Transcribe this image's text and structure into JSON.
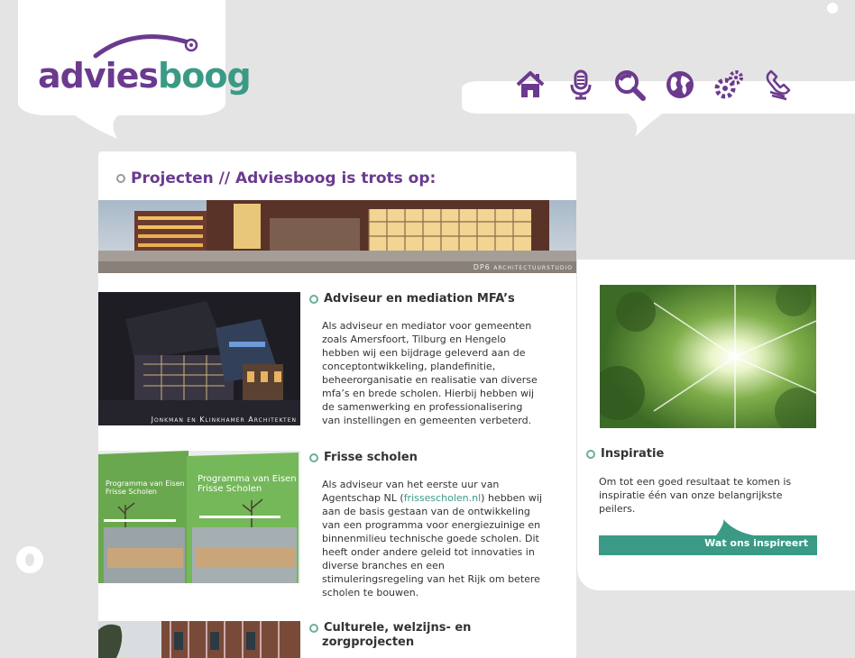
{
  "logo": {
    "part1": "advies",
    "part2": "boog"
  },
  "nav": [
    {
      "name": "home-icon"
    },
    {
      "name": "microphone-icon"
    },
    {
      "name": "search-icon"
    },
    {
      "name": "globe-icon"
    },
    {
      "name": "gears-icon"
    },
    {
      "name": "phone-icon"
    }
  ],
  "page_title": "Projecten // Adviesboog is trots op:",
  "banner": {
    "credit": "DP6 architectuurstudio"
  },
  "projects": [
    {
      "title": "Adviseur en mediation MFA’s",
      "credit": "Jonkman en Klinkhamer Architekten",
      "text": "Als adviseur en mediator voor gemeenten zoals Amersfoort, Tilburg en Hengelo hebben wij een bijdrage geleverd aan de conceptontwikkeling, plandefinitie, beheerorganisatie en realisatie van diverse mfa’s en brede scholen. Hierbij hebben wij de samenwerking en professionalisering van instellingen en gemeenten verbeterd."
    },
    {
      "title": "Frisse scholen",
      "text_before": "Als adviseur van het eerste uur van Agentschap NL (",
      "link": "frissescholen.nl",
      "text_after": ") hebben wij aan de basis gestaan van de ontwikkeling van een programma voor energiezuinige en binnenmilieu technische goede scholen. Dit heeft onder andere geleid tot innovaties in diverse branches en een stimuleringsregeling van het Rijk om betere scholen te bouwen.",
      "cover": {
        "line1": "Programma van Eisen",
        "line2": "Frisse Scholen"
      }
    },
    {
      "title_line1": "Culturele, welzijns- en",
      "title_line2": "zorgprojecten"
    }
  ],
  "inspiratie": {
    "title": "Inspiratie",
    "text": "Om tot een goed resultaat te komen is inspiratie één van onze belangrijkste peilers.",
    "button": "Wat ons inspireert"
  },
  "colors": {
    "purple": "#6b3a8e",
    "teal": "#3a9a86",
    "background": "#e4e4e4"
  }
}
